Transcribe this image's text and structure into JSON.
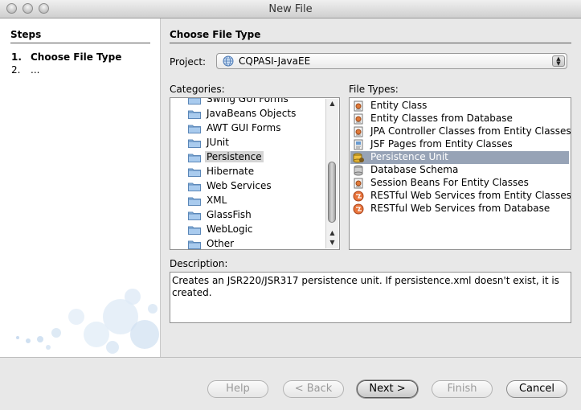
{
  "window": {
    "title": "New File"
  },
  "steps": {
    "heading": "Steps",
    "items": [
      {
        "num": "1.",
        "label": "Choose File Type"
      },
      {
        "num": "2.",
        "label": "..."
      }
    ]
  },
  "main": {
    "heading": "Choose File Type",
    "project_label": "Project:",
    "project_value": "CQPASI-JavaEE",
    "categories_label": "Categories:",
    "categories": [
      "Swing GUI Forms",
      "JavaBeans Objects",
      "AWT GUI Forms",
      "JUnit",
      "Persistence",
      "Hibernate",
      "Web Services",
      "XML",
      "GlassFish",
      "WebLogic",
      "Other"
    ],
    "selected_category": "Persistence",
    "file_types_label": "File Types:",
    "file_types": [
      "Entity Class",
      "Entity Classes from Database",
      "JPA Controller Classes from Entity Classes",
      "JSF Pages from Entity Classes",
      "Persistence Unit",
      "Database Schema",
      "Session Beans For Entity Classes",
      "RESTful Web Services from Entity Classes",
      "RESTful Web Services from Database"
    ],
    "selected_file_type": "Persistence Unit",
    "description_label": "Description:",
    "description": "Creates an JSR220/JSR317 persistence unit. If persistence.xml doesn't exist, it is created."
  },
  "buttons": {
    "help": "Help",
    "back": "< Back",
    "next": "Next >",
    "finish": "Finish",
    "cancel": "Cancel"
  },
  "colors": {
    "selection": "#97a3b6",
    "folder": "#8fb8e0"
  }
}
